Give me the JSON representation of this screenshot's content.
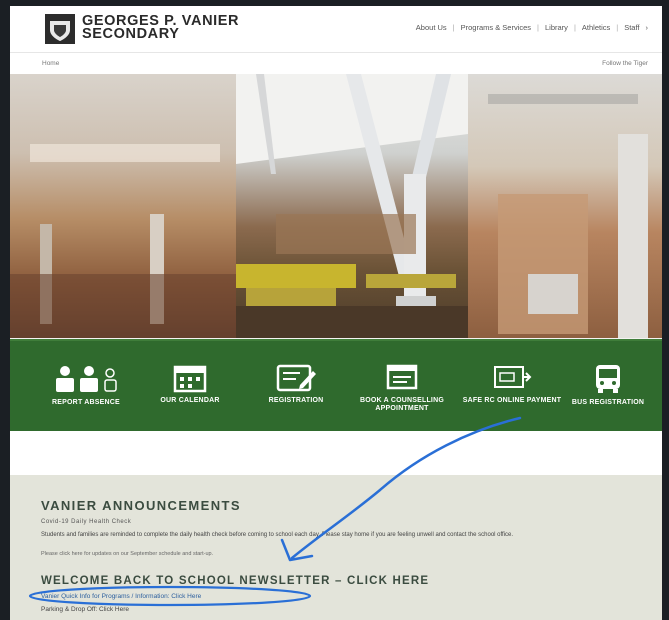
{
  "header": {
    "school_name_line1": "GEORGES P. VANIER",
    "school_name_line2": "SECONDARY",
    "nav": [
      "About Us",
      "Programs & Services",
      "Library",
      "Athletics",
      "Staff"
    ],
    "nav_extra": "›"
  },
  "subbar": {
    "breadcrumb": "Home",
    "right": "Follow the Tiger"
  },
  "quick_links": [
    {
      "label": "Report Absence",
      "icon": "report-absence-icon"
    },
    {
      "label": "Our Calendar",
      "icon": "calendar-icon"
    },
    {
      "label": "Registration",
      "icon": "registration-icon"
    },
    {
      "label": "Book a Counselling Appointment",
      "icon": "counselling-icon"
    },
    {
      "label": "Safe RC Online Payment",
      "icon": "online-payment-icon"
    },
    {
      "label": "Bus Registration",
      "icon": "bus-icon"
    }
  ],
  "announcements": {
    "title": "VANIER ANNOUNCEMENTS",
    "subtitle": "Covid-19 Daily Health Check",
    "text": "Students and families are reminded to complete the daily health check before coming to school each day. Please stay home if you are feeling unwell and contact the school office.",
    "text2": "Please click here for updates on our September schedule and start-up.",
    "newsletter": "WELCOME BACK TO SCHOOL NEWSLETTER – CLICK HERE",
    "link1": "Vanier Quick Info for Programs / Information: Click Here",
    "link2": "Parking & Drop Off: Click Here"
  },
  "colors": {
    "green_bar": "#2f6a2d",
    "annotation_blue": "#2a6fd6"
  }
}
